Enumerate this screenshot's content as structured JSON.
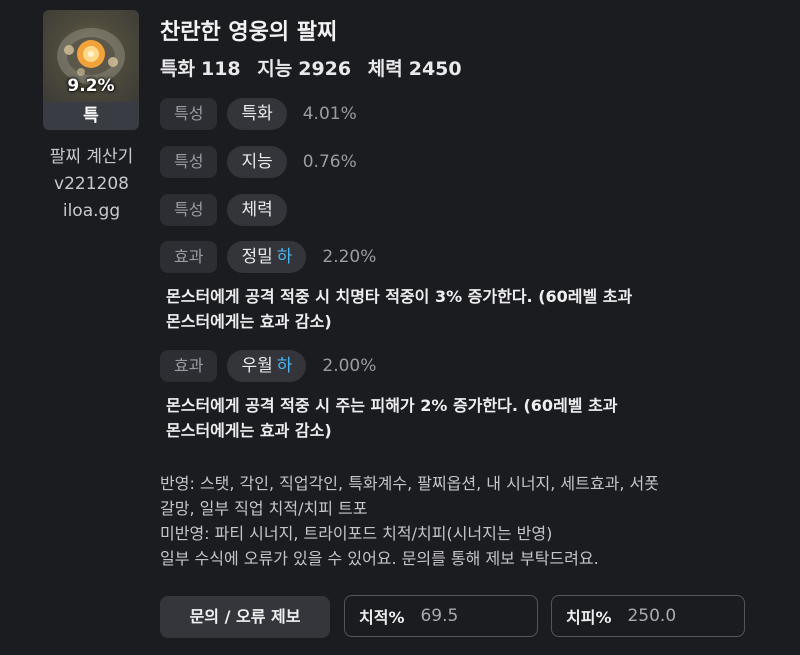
{
  "item": {
    "percent": "9.2%",
    "grade": "특",
    "title": "찬란한 영웅의 팔찌",
    "image_icon": "bracelet-icon"
  },
  "calculator": {
    "name": "팔찌 계산기",
    "version": "v221208",
    "site": "iloa.gg"
  },
  "stats": [
    {
      "name": "특화",
      "value": "118"
    },
    {
      "name": "지능",
      "value": "2926"
    },
    {
      "name": "체력",
      "value": "2450"
    }
  ],
  "attributes": [
    {
      "type": "특성",
      "name": "특화",
      "grade": "",
      "value": "4.01%"
    },
    {
      "type": "특성",
      "name": "지능",
      "grade": "",
      "value": "0.76%"
    },
    {
      "type": "특성",
      "name": "체력",
      "grade": "",
      "value": ""
    },
    {
      "type": "효과",
      "name": "정밀",
      "grade": "하",
      "value": "2.20%",
      "desc_lines": [
        "몬스터에게 공격 적중 시 치명타 적중이 3% 증가한다. (60레벨 초과",
        "몬스터에게는 효과 감소)"
      ]
    },
    {
      "type": "효과",
      "name": "우월",
      "grade": "하",
      "value": "2.00%",
      "desc_lines": [
        "몬스터에게 공격 적중 시 주는 피해가 2% 증가한다. (60레벨 초과",
        "몬스터에게는 효과 감소)"
      ]
    }
  ],
  "notes": [
    "반영: 스탯, 각인, 직업각인, 특화계수, 팔찌옵션, 내 시너지, 세트효과, 서폿",
    "갈망, 일부 직업 치적/치피 트포",
    "미반영: 파티 시너지, 트라이포드 치적/치피(시너지는 반영)",
    "일부 수식에 오류가 있을 수 있어요. 문의를 통해 제보 부탁드려요."
  ],
  "footer": {
    "report_label": "문의 / 오류 제보",
    "crit_rate_label": "치적%",
    "crit_rate_value": "69.5",
    "crit_dmg_label": "치피%",
    "crit_dmg_value": "250.0"
  },
  "colors": {
    "background": "#1b1c20",
    "grade_accent": "#4db4f0"
  }
}
